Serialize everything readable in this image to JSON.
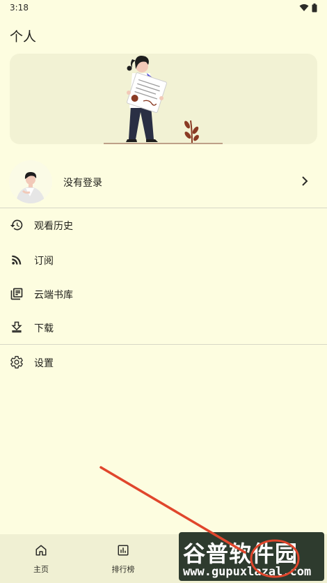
{
  "status_bar": {
    "time": "3:18"
  },
  "page": {
    "title": "个人"
  },
  "profile": {
    "label": "没有登录"
  },
  "menu": [
    {
      "label": "观看历史",
      "icon": "history-icon"
    },
    {
      "label": "订阅",
      "icon": "rss-icon"
    },
    {
      "label": "云端书库",
      "icon": "library-icon"
    },
    {
      "label": "下载",
      "icon": "download-icon"
    },
    {
      "label": "设置",
      "icon": "gear-icon"
    }
  ],
  "bottom_nav": [
    {
      "label": "主页",
      "icon": "home-icon"
    },
    {
      "label": "排行榜",
      "icon": "chart-icon"
    }
  ],
  "watermark": {
    "main": "谷普软件园",
    "url": "www.gupuxlazal.com"
  },
  "colors": {
    "background": "#fdfde0",
    "card": "#f2f2d4",
    "accent_red": "#e0462c"
  }
}
